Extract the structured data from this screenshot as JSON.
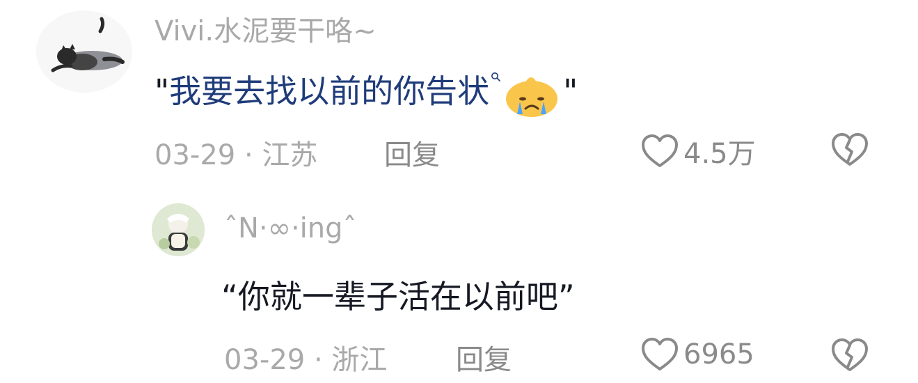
{
  "comment": {
    "username": "Vivi.水泥要干咯~",
    "text_open": "\"",
    "text": "我要去找以前的你告状",
    "emoji": "crying-face-emoji",
    "text_close": "\"",
    "date_location": "03-29 · 江苏",
    "reply_label": "回复",
    "likes": "4.5万"
  },
  "reply": {
    "username": "ˆN·∞·ingˆ",
    "text": "“你就一辈子活在以前吧”",
    "date_location": "03-29 · 浙江",
    "reply_label": "回复",
    "likes": "6965"
  },
  "colors": {
    "username": "#a9a9a9",
    "link_text": "#1f3c7a",
    "body_text": "#161823",
    "meta": "#a9a9a9",
    "icon": "#8a8a8a"
  },
  "icons": {
    "like": "heart-outline-icon",
    "dislike": "broken-heart-icon",
    "search": "search-icon"
  }
}
